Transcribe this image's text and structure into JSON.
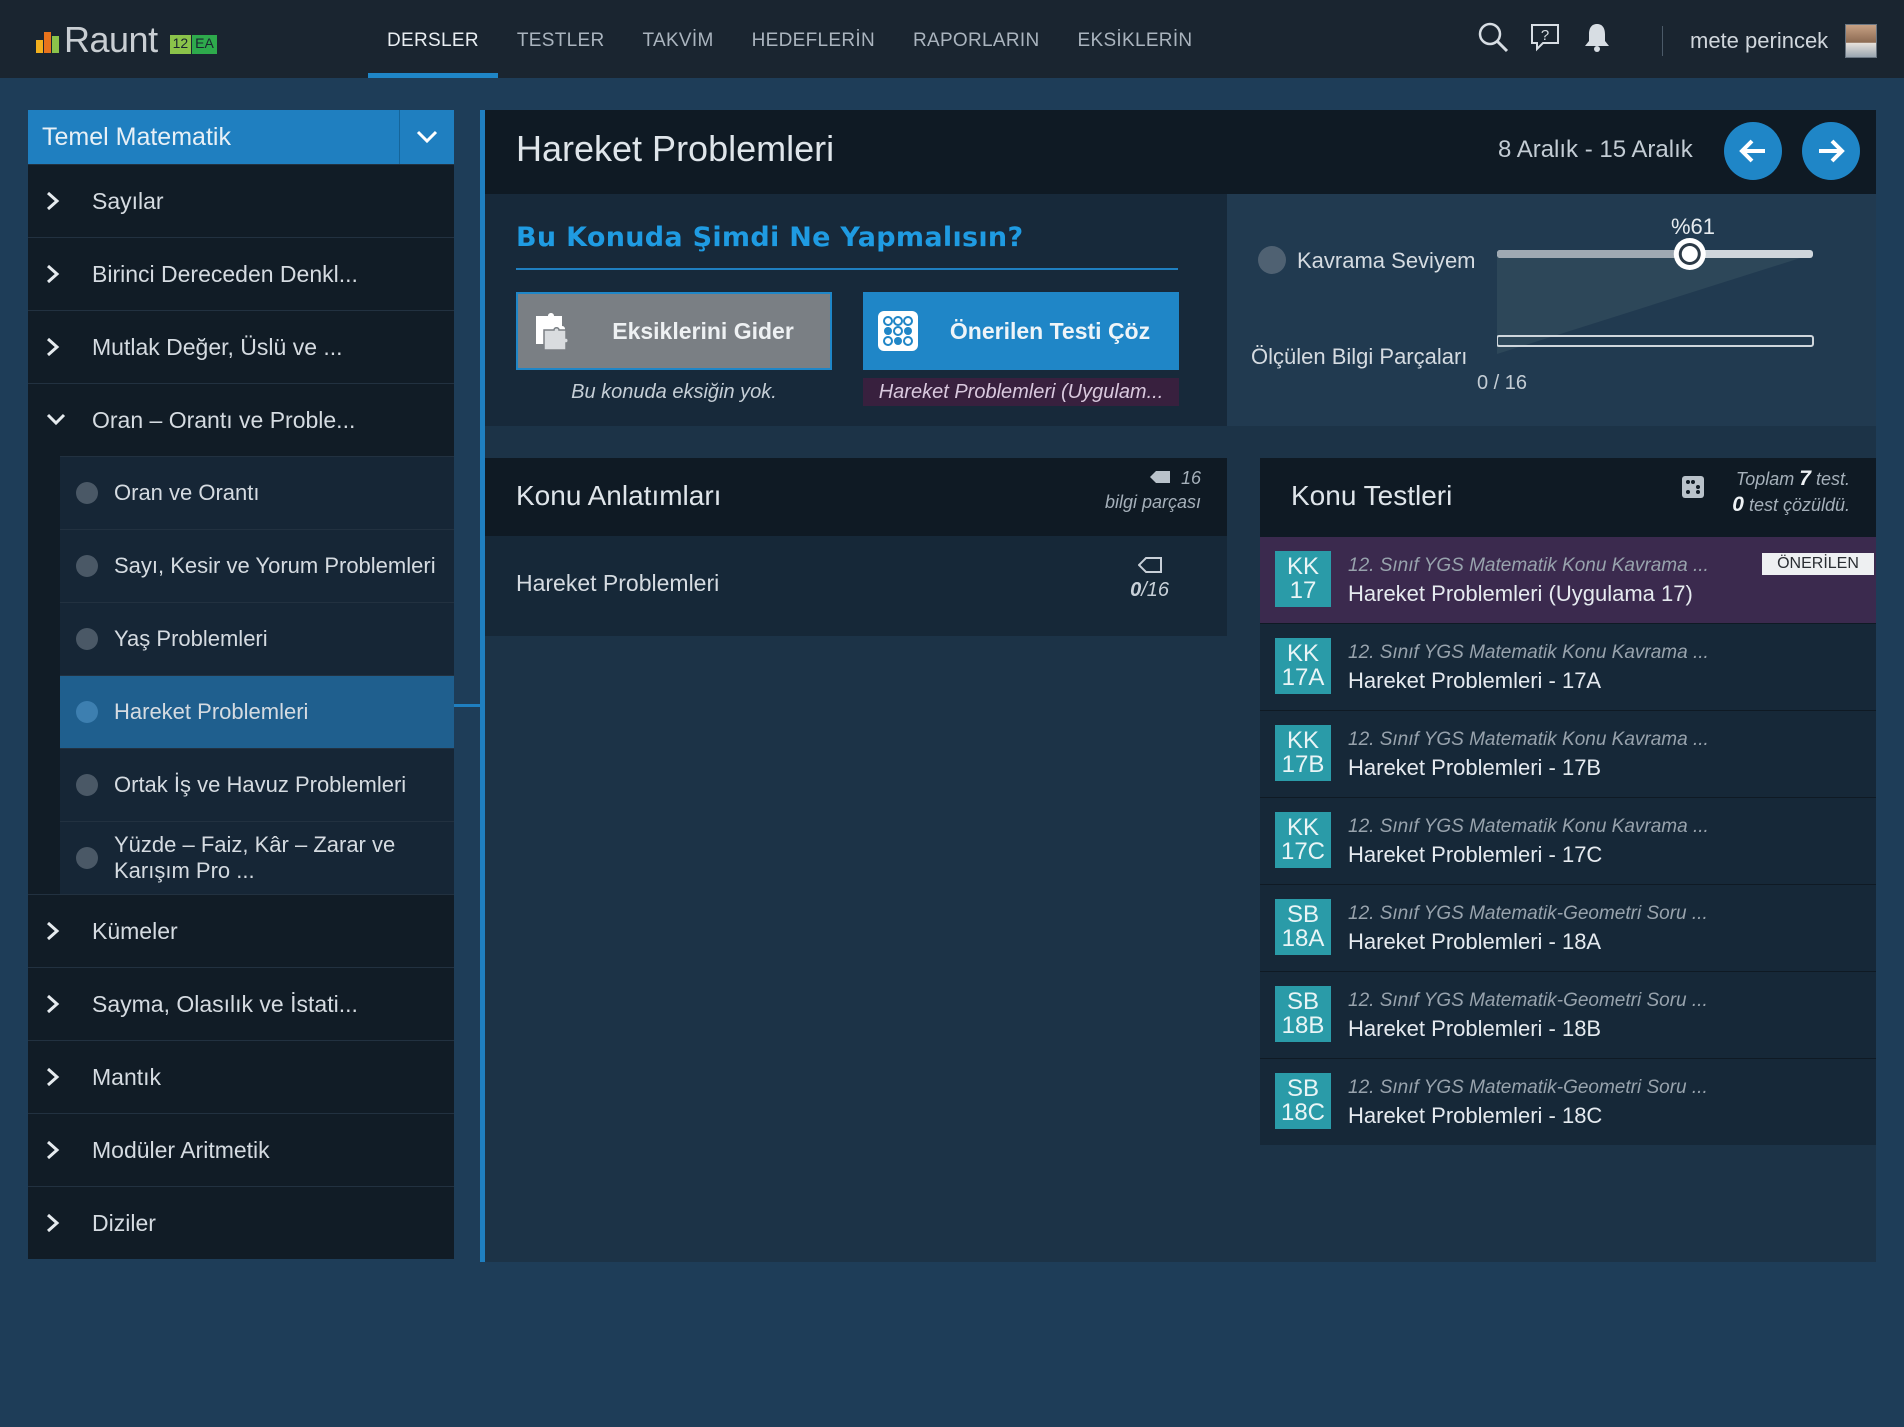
{
  "app": {
    "logo_text": "Raunt",
    "badge_grade": "12",
    "badge_track": "EA",
    "user_name": "mete perincek"
  },
  "nav": {
    "items": [
      "DERSLER",
      "TESTLER",
      "TAKVİM",
      "HEDEFLERİN",
      "RAPORLARIN",
      "EKSİKLERİN"
    ],
    "active": "DERSLER"
  },
  "sidebar": {
    "subject": "Temel Matematik",
    "topics_before": [
      "Sayılar",
      "Birinci Dereceden Denkl...",
      "Mutlak Değer, Üslü ve ..."
    ],
    "expanded_topic": "Oran – Orantı ve Proble...",
    "subtopics": [
      {
        "label": "Oran ve Orantı",
        "active": false
      },
      {
        "label": "Sayı, Kesir ve Yorum Problemleri",
        "active": false
      },
      {
        "label": "Yaş Problemleri",
        "active": false
      },
      {
        "label": "Hareket Problemleri",
        "active": true
      },
      {
        "label": "Ortak İş ve Havuz Problemleri",
        "active": false
      },
      {
        "label": "Yüzde – Faiz, Kâr – Zarar ve Karışım Pro ...",
        "active": false
      }
    ],
    "topics_after": [
      "Kümeler",
      "Sayma, Olasılık ve İstati...",
      "Mantık",
      "Modüler Aritmetik",
      "Diziler"
    ]
  },
  "main": {
    "title": "Hareket Problemleri",
    "date_range": "8 Aralık - 15 Aralık"
  },
  "todo": {
    "title": "Bu Konuda Şimdi Ne Yapmalısın?",
    "btn_fix": "Eksiklerini Gider",
    "btn_fix_caption": "Bu konuda eksiğin yok.",
    "btn_test": "Önerilen Testi Çöz",
    "btn_test_caption": "Hareket Problemleri (Uygulam..."
  },
  "level": {
    "label": "Kavrama Seviyem",
    "percent_text": "%61",
    "percent_value": 0.61,
    "measured_label": "Ölçülen Bilgi Parçaları",
    "measured_count": "0 / 16",
    "measured_value": 0
  },
  "lectures": {
    "title": "Konu Anlatımları",
    "count_num": "16",
    "count_label": "bilgi parçası",
    "items": [
      {
        "label": "Hareket Problemleri",
        "done": "0",
        "total": "/16"
      }
    ]
  },
  "tests": {
    "title": "Konu Testleri",
    "total_prefix": "Toplam",
    "total_num": "7",
    "total_suffix": "test.",
    "solved_num": "0",
    "solved_suffix": "test çözüldü.",
    "recommended_tag": "ÖNERİLEN",
    "items": [
      {
        "badge_top": "KK",
        "badge_bottom": "17",
        "series": "12. Sınıf YGS Matematik Konu Kavrama ...",
        "name": "Hareket Problemleri (Uygulama 17)",
        "recommended": true
      },
      {
        "badge_top": "KK",
        "badge_bottom": "17A",
        "series": "12. Sınıf YGS Matematik Konu Kavrama ...",
        "name": "Hareket Problemleri - 17A",
        "recommended": false
      },
      {
        "badge_top": "KK",
        "badge_bottom": "17B",
        "series": "12. Sınıf YGS Matematik Konu Kavrama ...",
        "name": "Hareket Problemleri - 17B",
        "recommended": false
      },
      {
        "badge_top": "KK",
        "badge_bottom": "17C",
        "series": "12. Sınıf YGS Matematik Konu Kavrama ...",
        "name": "Hareket Problemleri - 17C",
        "recommended": false
      },
      {
        "badge_top": "SB",
        "badge_bottom": "18A",
        "series": "12. Sınıf YGS Matematik-Geometri Soru ...",
        "name": "Hareket Problemleri - 18A",
        "recommended": false
      },
      {
        "badge_top": "SB",
        "badge_bottom": "18B",
        "series": "12. Sınıf YGS Matematik-Geometri Soru ...",
        "name": "Hareket Problemleri - 18B",
        "recommended": false
      },
      {
        "badge_top": "SB",
        "badge_bottom": "18C",
        "series": "12. Sınıf YGS Matematik-Geometri Soru ...",
        "name": "Hareket Problemleri - 18C",
        "recommended": false
      }
    ]
  },
  "icons": {
    "search": "search-icon",
    "help": "help-icon",
    "notifications": "bell-icon",
    "prev": "arrow-left-icon",
    "next": "arrow-right-icon"
  },
  "colors": {
    "accent": "#1f86c7",
    "recommended_row": "#3b2a4e",
    "badge": "#2a9ba8"
  }
}
